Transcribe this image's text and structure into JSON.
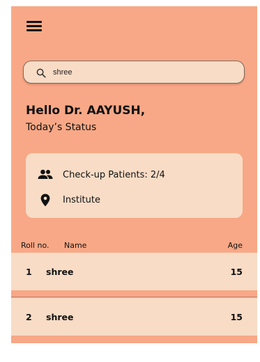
{
  "colors": {
    "background": "#f8a886",
    "card": "#f8dcc6",
    "text": "#111111"
  },
  "header": {
    "menu_icon": "hamburger-menu-icon"
  },
  "search": {
    "icon": "search-icon",
    "value": "shree",
    "placeholder": ""
  },
  "greeting": {
    "title": "Hello Dr. AAYUSH,",
    "subtitle": "Today’s Status"
  },
  "status": {
    "checkup": {
      "icon": "people-icon",
      "label": "Check-up Patients:  2/4"
    },
    "location": {
      "icon": "location-pin-icon",
      "label": "Institute"
    }
  },
  "table": {
    "headers": {
      "roll": "Roll no.",
      "name": "Name",
      "age": "Age"
    },
    "rows": [
      {
        "roll": "1",
        "name": "shree",
        "age": "15"
      },
      {
        "roll": "2",
        "name": "shree",
        "age": "15"
      }
    ]
  }
}
